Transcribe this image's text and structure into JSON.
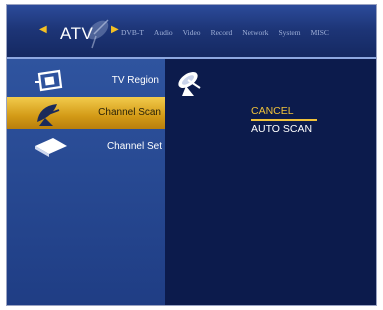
{
  "topbar": {
    "current_tab": "ATV",
    "tabs": [
      "DVB-T",
      "Audio",
      "Video",
      "Record",
      "Network",
      "System",
      "MISC"
    ]
  },
  "sidebar": {
    "items": [
      {
        "label": "TV Region",
        "icon": "tv-region-icon",
        "selected": false
      },
      {
        "label": "Channel Scan",
        "icon": "satellite-dish-icon",
        "selected": true
      },
      {
        "label": "Channel Set",
        "icon": "channel-set-icon",
        "selected": false
      }
    ]
  },
  "content": {
    "icon": "satellite-dish-icon",
    "options": {
      "cancel": "CANCEL",
      "auto_scan": "AUTO SCAN"
    }
  },
  "colors": {
    "highlight": "#f0c23a",
    "sidebar": "#2a4b96",
    "background": "#0b1846"
  }
}
